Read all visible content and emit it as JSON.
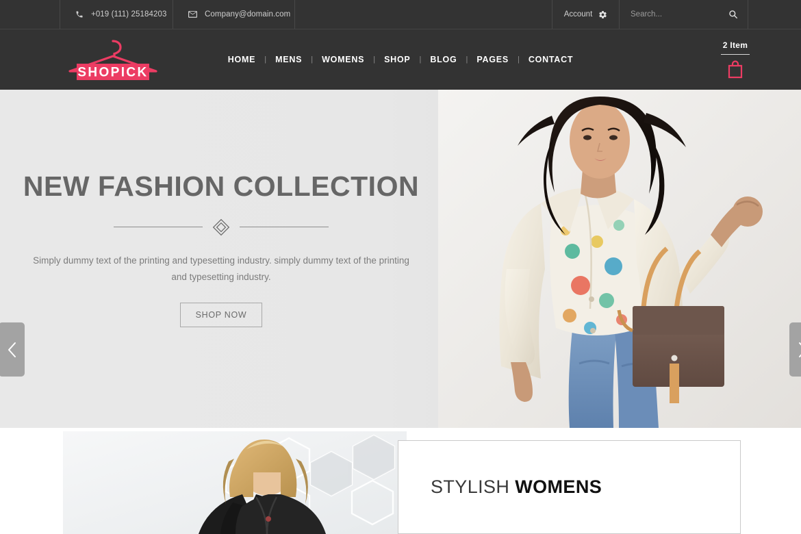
{
  "topbar": {
    "phone": "+019 (111) 25184203",
    "email": "Company@domain.com",
    "account_label": "Account",
    "search_placeholder": "Search...",
    "search_value": "",
    "phone_icon": "phone-icon",
    "mail_icon": "envelope-icon",
    "gear_icon": "gear-icon",
    "search_icon": "magnifier-icon"
  },
  "header": {
    "logo_text": "SHOPICK",
    "logo_icon": "clothes-hanger-icon",
    "nav": [
      {
        "label": "HOME"
      },
      {
        "label": "MENS"
      },
      {
        "label": "WOMENS"
      },
      {
        "label": "SHOP"
      },
      {
        "label": "BLOG"
      },
      {
        "label": "PAGES"
      },
      {
        "label": "CONTACT"
      }
    ],
    "nav_separator": "|",
    "cart": {
      "count_label": "2 Item",
      "icon": "shopping-bag-icon"
    }
  },
  "hero": {
    "title": "NEW FASHION COLLECTION",
    "divider_icon": "double-diamond-ornament",
    "description": "Simply dummy text of the printing and typesetting industry. simply dummy text of the printing and typesetting industry.",
    "cta_label": "SHOP NOW",
    "prev_icon": "chevron-left-icon",
    "next_icon": "chevron-right-icon",
    "image_alt": "woman-in-cream-coat-with-handbag"
  },
  "promo": {
    "image_alt": "woman-in-black-coat",
    "title_light": "STYLISH",
    "title_bold": "WOMENS"
  },
  "colors": {
    "accent": "#ec3c63",
    "header_bg": "#333333",
    "hero_bg": "#e8e8e8",
    "title_text": "#666666",
    "body_text": "#7c7c7c",
    "arrow_bg": "#a3a3a3"
  }
}
